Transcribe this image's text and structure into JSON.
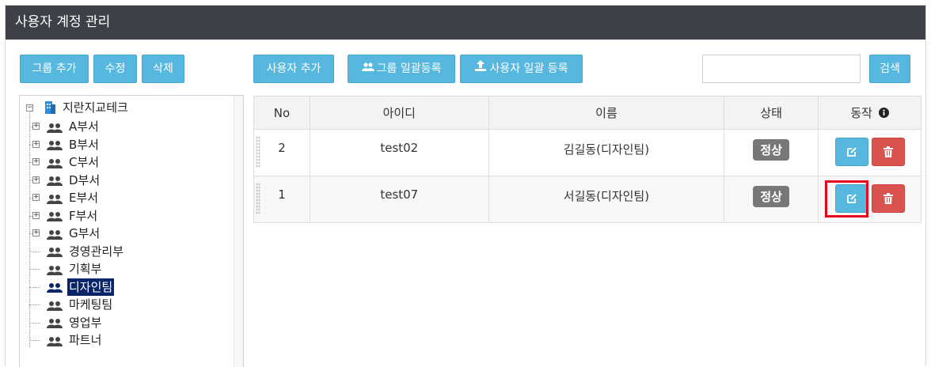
{
  "header": {
    "title": "사용자 계정 관리"
  },
  "toolbar": {
    "add_group": "그룹 추가",
    "edit": "수정",
    "delete": "삭제",
    "add_user": "사용자 추가",
    "group_bulk": "그룹 일괄등록",
    "user_bulk": "사용자 일괄 등록",
    "search_value": "",
    "search_button": "검색"
  },
  "tree": {
    "root": "지란지교테크",
    "items": [
      {
        "label": "A부서",
        "expandable": true
      },
      {
        "label": "B부서",
        "expandable": true
      },
      {
        "label": "C부서",
        "expandable": true
      },
      {
        "label": "D부서",
        "expandable": true
      },
      {
        "label": "E부서",
        "expandable": true
      },
      {
        "label": "F부서",
        "expandable": true
      },
      {
        "label": "G부서",
        "expandable": true
      },
      {
        "label": "경영관리부",
        "expandable": false
      },
      {
        "label": "기획부",
        "expandable": false
      },
      {
        "label": "디자인팀",
        "expandable": false,
        "selected": true
      },
      {
        "label": "마케팅팀",
        "expandable": false
      },
      {
        "label": "영업부",
        "expandable": false
      },
      {
        "label": "파트너",
        "expandable": false
      }
    ]
  },
  "table": {
    "headers": [
      "No",
      "아이디",
      "이름",
      "상태",
      "동작"
    ],
    "rows": [
      {
        "no": "2",
        "id": "test02",
        "name": "김길동(디자인팀)",
        "status": "정상"
      },
      {
        "no": "1",
        "id": "test07",
        "name": "서길동(디자인팀)",
        "status": "정상"
      }
    ]
  },
  "colors": {
    "header_bg": "#3d4047",
    "primary": "#56b7df",
    "danger": "#d9534f",
    "badge": "#777777",
    "selected": "#0a246a",
    "highlight": "#e8001c"
  }
}
